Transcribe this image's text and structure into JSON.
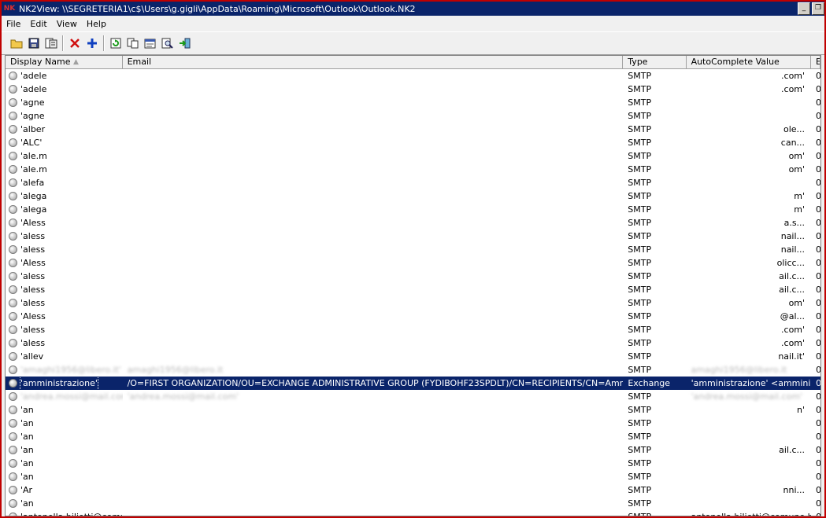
{
  "window": {
    "title": "NK2View:  \\\\SEGRETERIA1\\c$\\Users\\g.gigli\\AppData\\Roaming\\Microsoft\\Outlook\\Outlook.NK2"
  },
  "menu": [
    "File",
    "Edit",
    "View",
    "Help"
  ],
  "toolbar": [
    "open-icon",
    "save-icon",
    "save-html-icon",
    "delete-icon",
    "add-icon",
    "refresh-icon",
    "copy-icon",
    "properties-icon",
    "find-icon",
    "exit-icon"
  ],
  "columns": {
    "name": "Display Name",
    "email": "Email",
    "type": "Type",
    "auto": "AutoComplete Value",
    "extra": "E"
  },
  "rows": [
    {
      "name": "'adele",
      "email": "",
      "type": "SMTP",
      "auto": ".com'",
      "extra": "0"
    },
    {
      "name": "'adele",
      "email": "",
      "type": "SMTP",
      "auto": ".com'",
      "extra": "0"
    },
    {
      "name": "'agne",
      "email": "",
      "type": "SMTP",
      "auto": "",
      "extra": "0"
    },
    {
      "name": "'agne",
      "email": "",
      "type": "SMTP",
      "auto": "",
      "extra": "0"
    },
    {
      "name": "'alber",
      "email": "",
      "type": "SMTP",
      "auto": "ole...",
      "extra": "0"
    },
    {
      "name": "'ALC'",
      "email": "",
      "type": "SMTP",
      "auto": "can...",
      "extra": "0"
    },
    {
      "name": "'ale.m",
      "email": "",
      "type": "SMTP",
      "auto": "om'",
      "extra": "0"
    },
    {
      "name": "'ale.m",
      "email": "",
      "type": "SMTP",
      "auto": "om'",
      "extra": "0"
    },
    {
      "name": "'alefa",
      "email": "",
      "type": "SMTP",
      "auto": "",
      "extra": "0"
    },
    {
      "name": "'alega",
      "email": "",
      "type": "SMTP",
      "auto": "m'",
      "extra": "0"
    },
    {
      "name": "'alega",
      "email": "",
      "type": "SMTP",
      "auto": "m'",
      "extra": "0"
    },
    {
      "name": "'Aless",
      "email": "",
      "type": "SMTP",
      "auto": "a.s...",
      "extra": "0"
    },
    {
      "name": "'aless",
      "email": "",
      "type": "SMTP",
      "auto": "nail...",
      "extra": "0"
    },
    {
      "name": "'aless",
      "email": "",
      "type": "SMTP",
      "auto": "nail...",
      "extra": "0"
    },
    {
      "name": "'Aless",
      "email": "",
      "type": "SMTP",
      "auto": "olicc...",
      "extra": "0"
    },
    {
      "name": "'aless",
      "email": "",
      "type": "SMTP",
      "auto": "ail.c...",
      "extra": "0"
    },
    {
      "name": "'aless",
      "email": "",
      "type": "SMTP",
      "auto": "ail.c...",
      "extra": "0"
    },
    {
      "name": "'aless",
      "email": "",
      "type": "SMTP",
      "auto": "om'",
      "extra": "0"
    },
    {
      "name": "'Aless",
      "email": "",
      "type": "SMTP",
      "auto": "@al...",
      "extra": "0"
    },
    {
      "name": "'aless",
      "email": "",
      "type": "SMTP",
      "auto": ".com'",
      "extra": "0"
    },
    {
      "name": "'aless",
      "email": "",
      "type": "SMTP",
      "auto": ".com'",
      "extra": "0"
    },
    {
      "name": "'allev",
      "email": "",
      "type": "SMTP",
      "auto": "nail.it'",
      "extra": "0"
    },
    {
      "name": "'amaghi1956@libero.it'",
      "email": "amaghi1956@libero.it",
      "type": "SMTP",
      "auto": "amaghi1956@libero.it",
      "extra": "0",
      "blur": true
    },
    {
      "name": "'amministrazione'",
      "email": "/O=FIRST ORGANIZATION/OU=EXCHANGE ADMINISTRATIVE GROUP (FYDIBOHF23SPDLT)/CN=RECIPIENTS/CN=Amministrazione",
      "type": "Exchange",
      "auto": "'amministrazione'  <amminist...",
      "extra": "0",
      "selected": true
    },
    {
      "name": "'andrea.mossi@mail.com'",
      "email": "'andrea.mossi@mail.com'",
      "type": "SMTP",
      "auto": "'andrea.mossi@mail.com'",
      "extra": "0",
      "blur": true
    },
    {
      "name": "'an",
      "email": "",
      "type": "SMTP",
      "auto": "n'",
      "extra": "0"
    },
    {
      "name": "'an",
      "email": "",
      "type": "SMTP",
      "auto": "",
      "extra": "0"
    },
    {
      "name": "'an",
      "email": "",
      "type": "SMTP",
      "auto": "",
      "extra": "0"
    },
    {
      "name": "'an",
      "email": "",
      "type": "SMTP",
      "auto": "ail.c...",
      "extra": "0"
    },
    {
      "name": "'an",
      "email": "",
      "type": "SMTP",
      "auto": "",
      "extra": "0"
    },
    {
      "name": "'an",
      "email": "",
      "type": "SMTP",
      "auto": "",
      "extra": "0"
    },
    {
      "name": "'Ar",
      "email": "",
      "type": "SMTP",
      "auto": "nni...",
      "extra": "0"
    },
    {
      "name": "'an",
      "email": "",
      "type": "SMTP",
      "auto": "",
      "extra": "0"
    },
    {
      "name": "'antonella.biliotti@comu",
      "email": "",
      "type": "SMTP",
      "auto": "antonella.biliotti@comune.b...",
      "extra": "0"
    }
  ]
}
